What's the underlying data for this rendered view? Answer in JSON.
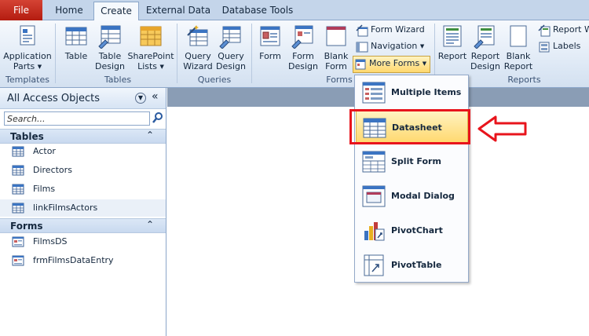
{
  "tabs": {
    "file": "File",
    "home": "Home",
    "create": "Create",
    "external": "External Data",
    "dbtools": "Database Tools"
  },
  "ribbon": {
    "templates": {
      "label": "Templates",
      "app_parts_1": "Application",
      "app_parts_2": "Parts",
      "app_parts_icon": "application-parts-icon"
    },
    "tables": {
      "label": "Tables",
      "table": "Table",
      "table_design_1": "Table",
      "table_design_2": "Design",
      "sharepoint_1": "SharePoint",
      "sharepoint_2": "Lists"
    },
    "queries": {
      "label": "Queries",
      "wizard_1": "Query",
      "wizard_2": "Wizard",
      "design_1": "Query",
      "design_2": "Design"
    },
    "forms": {
      "label": "Forms",
      "form": "Form",
      "form_design_1": "Form",
      "form_design_2": "Design",
      "blank_form_1": "Blank",
      "blank_form_2": "Form",
      "form_wizard": "Form Wizard",
      "navigation": "Navigation",
      "more_forms": "More Forms"
    },
    "reports": {
      "label": "Reports",
      "report": "Report",
      "report_design_1": "Report",
      "report_design_2": "Design",
      "blank_report_1": "Blank",
      "blank_report_2": "Report",
      "report_wizard": "Report W",
      "labels": "Labels"
    }
  },
  "nav": {
    "title": "All Access Objects",
    "search_placeholder": "Search...",
    "categories": {
      "tables": "Tables",
      "forms": "Forms"
    },
    "tables": [
      "Actor",
      "Directors",
      "Films",
      "linkFilmsActors"
    ],
    "forms": [
      "FilmsDS",
      "frmFilmsDataEntry"
    ]
  },
  "more_forms_menu": {
    "items": [
      "Multiple Items",
      "Datasheet",
      "Split Form",
      "Modal Dialog",
      "PivotChart",
      "PivotTable"
    ],
    "highlighted": "Datasheet"
  },
  "colors": {
    "accent_red": "#e8141c",
    "file_tab": "#c42b1c",
    "highlight": "#ffd86e"
  }
}
